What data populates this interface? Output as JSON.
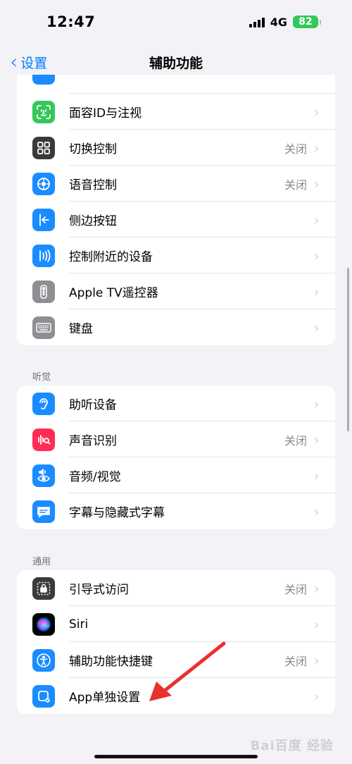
{
  "status_bar": {
    "time": "12:47",
    "network": "4G",
    "battery": "82"
  },
  "nav": {
    "back_label": "设置",
    "title": "辅助功能"
  },
  "groups": [
    {
      "items": [
        {
          "label": "面容ID与注视",
          "value": "",
          "icon": "face-id-icon",
          "color": "#34c759"
        },
        {
          "label": "切换控制",
          "value": "关闭",
          "icon": "switch-control-icon",
          "color": "#3a3a3c"
        },
        {
          "label": "语音控制",
          "value": "关闭",
          "icon": "voice-control-icon",
          "color": "#1a8cff"
        },
        {
          "label": "侧边按钮",
          "value": "",
          "icon": "side-button-icon",
          "color": "#1a8cff"
        },
        {
          "label": "控制附近的设备",
          "value": "",
          "icon": "nearby-devices-icon",
          "color": "#1a8cff"
        },
        {
          "label": "Apple TV遥控器",
          "value": "",
          "icon": "tv-remote-icon",
          "color": "#8e8e93"
        },
        {
          "label": "键盘",
          "value": "",
          "icon": "keyboard-icon",
          "color": "#8e8e93"
        }
      ]
    },
    {
      "header": "听觉",
      "items": [
        {
          "label": "助听设备",
          "value": "",
          "icon": "hearing-ear-icon",
          "color": "#1a8cff"
        },
        {
          "label": "声音识别",
          "value": "关闭",
          "icon": "sound-recognition-icon",
          "color": "#ff2d55"
        },
        {
          "label": "音频/视觉",
          "value": "",
          "icon": "audio-visual-icon",
          "color": "#1a8cff"
        },
        {
          "label": "字幕与隐藏式字幕",
          "value": "",
          "icon": "subtitles-icon",
          "color": "#1a8cff"
        }
      ]
    },
    {
      "header": "通用",
      "items": [
        {
          "label": "引导式访问",
          "value": "关闭",
          "icon": "guided-access-icon",
          "color": "#3a3a3c"
        },
        {
          "label": "Siri",
          "value": "",
          "icon": "siri-icon",
          "color": "#000000"
        },
        {
          "label": "辅助功能快捷键",
          "value": "关闭",
          "icon": "accessibility-shortcut-icon",
          "color": "#1a8cff"
        },
        {
          "label": "App单独设置",
          "value": "",
          "icon": "per-app-settings-icon",
          "color": "#1a8cff"
        }
      ]
    }
  ],
  "chevron_glyph": "›",
  "watermark": "Bai百度 经验",
  "annotation_color": "#e8322e"
}
